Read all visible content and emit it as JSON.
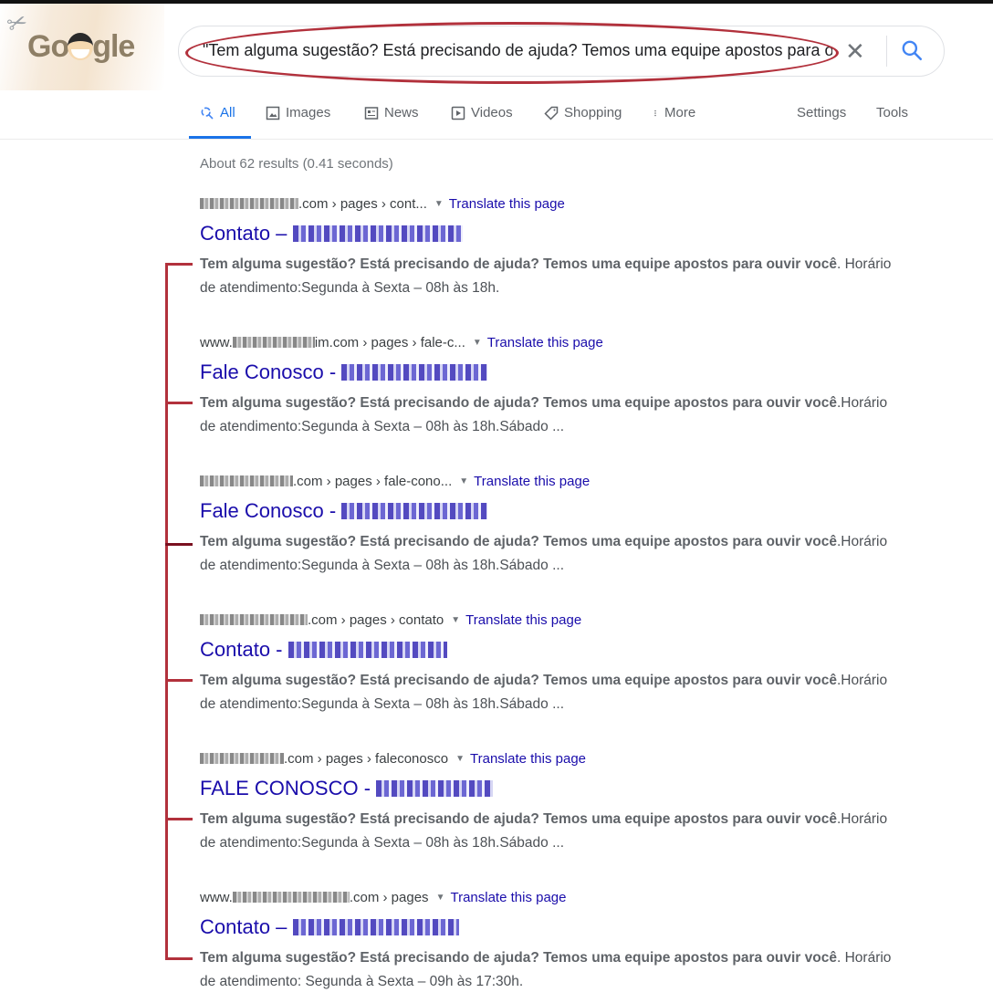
{
  "logo": {
    "text_before": "Go",
    "text_after": "gle",
    "doodle": "masked-barber-doodle"
  },
  "search": {
    "query": "\"Tem alguma sugestão? Está precisando de ajuda? Temos uma equipe apostos para ouvir você\"",
    "clear_icon": "close-icon",
    "search_icon": "magnifier-icon"
  },
  "tabs": [
    {
      "label": "All",
      "icon": "search-icon",
      "active": true
    },
    {
      "label": "Images",
      "icon": "image-icon"
    },
    {
      "label": "News",
      "icon": "news-icon"
    },
    {
      "label": "Videos",
      "icon": "play-icon"
    },
    {
      "label": "Shopping",
      "icon": "tag-icon"
    },
    {
      "label": "More",
      "icon": "dots-vertical-icon"
    },
    {
      "label": "Settings"
    },
    {
      "label": "Tools"
    }
  ],
  "stats": "About 62 results (0.41 seconds)",
  "translate_label": "Translate this page",
  "snippet_bold": "Tem alguma sugestão? Está precisando de ajuda? Temos uma equipe apostos para ouvir você",
  "results": [
    {
      "cite_prefix": "",
      "cite_suffix": ".com › pages › cont...",
      "title_prefix": "Contato – ",
      "snippet_rest": ". Horário de atendimento:Segunda à Sexta – 08h às 18h."
    },
    {
      "cite_prefix": "www.",
      "cite_suffix": "im.com › pages › fale-c...",
      "title_prefix": "Fale Conosco - ",
      "snippet_rest": ".Horário de atendimento:Segunda à Sexta – 08h às 18h.Sábado ..."
    },
    {
      "cite_prefix": "",
      "cite_suffix": ".com › pages › fale-cono...",
      "title_prefix": "Fale Conosco - ",
      "snippet_rest": ".Horário de atendimento:Segunda à Sexta – 08h às 18h.Sábado ..."
    },
    {
      "cite_prefix": "",
      "cite_suffix": ".com › pages › contato",
      "title_prefix": "Contato - ",
      "snippet_rest": ".Horário de atendimento:Segunda à Sexta – 08h às 18h.Sábado ..."
    },
    {
      "cite_prefix": "",
      "cite_suffix": ".com › pages › faleconosco",
      "title_prefix": "FALE CONOSCO - ",
      "snippet_rest": ".Horário de atendimento:Segunda à Sexta – 08h às 18h.Sábado ..."
    },
    {
      "cite_prefix": "www.",
      "cite_suffix": ".com › pages",
      "title_prefix": "Contato – ",
      "snippet_rest": ". Horário de atendimento: Segunda à Sexta – 09h às 17:30h."
    }
  ],
  "colors": {
    "annotation": "#b2313c",
    "link": "#1a0dab",
    "accent": "#1a73e8"
  }
}
